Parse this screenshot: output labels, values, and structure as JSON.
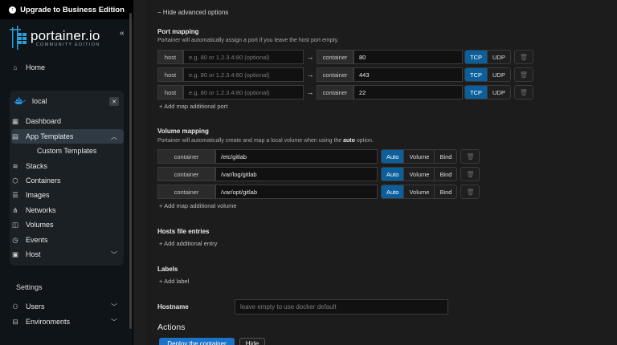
{
  "sidebar": {
    "upgrade_label": "Upgrade to Business Edition",
    "logo_title": "portainer.io",
    "logo_sub": "COMMUNITY EDITION",
    "collapse_icon": "«",
    "home_label": "Home",
    "env_name": "local",
    "env_close": "✕",
    "items": [
      {
        "label": "Dashboard"
      },
      {
        "label": "App Templates"
      },
      {
        "label": "Custom Templates"
      },
      {
        "label": "Stacks"
      },
      {
        "label": "Containers"
      },
      {
        "label": "Images"
      },
      {
        "label": "Networks"
      },
      {
        "label": "Volumes"
      },
      {
        "label": "Events"
      },
      {
        "label": "Host"
      }
    ],
    "settings_label": "Settings",
    "settings_items": [
      {
        "label": "Users"
      },
      {
        "label": "Environments"
      }
    ]
  },
  "main": {
    "hide_advanced": "Hide advanced options",
    "port_mapping": {
      "title": "Port mapping",
      "desc": "Portainer will automatically assign a port if you leave the host port empty.",
      "host_label": "host",
      "host_placeholder": "e.g. 80 or 1.2.3.4:80 (optional)",
      "container_label": "container",
      "rows": [
        {
          "container": "80"
        },
        {
          "container": "443"
        },
        {
          "container": "22"
        }
      ],
      "tcp": "TCP",
      "udp": "UDP",
      "add": "Add map additional port"
    },
    "volume_mapping": {
      "title": "Volume mapping",
      "desc_pre": "Portainer will automatically create and map a local volume when using the ",
      "desc_bold": "auto",
      "desc_post": " option.",
      "container_label": "container",
      "rows": [
        {
          "path": "/etc/gitlab"
        },
        {
          "path": "/var/log/gitlab"
        },
        {
          "path": "/var/opt/gitlab"
        }
      ],
      "auto": "Auto",
      "volume": "Volume",
      "bind": "Bind",
      "add": "Add map additional volume"
    },
    "hosts": {
      "title": "Hosts file entries",
      "add": "Add additional entry"
    },
    "labels": {
      "title": "Labels",
      "add": "Add label"
    },
    "hostname": {
      "label": "Hostname",
      "placeholder": "leave empty to use docker default"
    },
    "actions": {
      "title": "Actions",
      "deploy": "Deploy the container",
      "hide": "Hide"
    }
  },
  "colors": {
    "accent": "#0b5f9a",
    "deploy": "#1a73c7"
  }
}
